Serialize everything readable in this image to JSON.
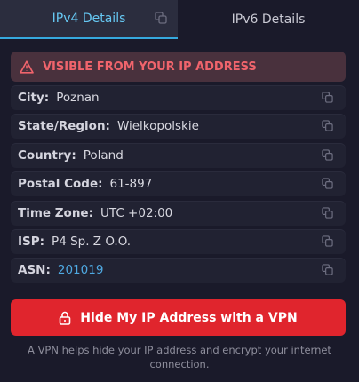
{
  "tabs": [
    {
      "label": "IPv4 Details"
    },
    {
      "label": "IPv6 Details"
    }
  ],
  "alert": {
    "text": "VISIBLE FROM YOUR IP ADDRESS",
    "icon": "warning-icon",
    "color": "#f0646c"
  },
  "details": [
    {
      "label": "City:",
      "value": "Poznan"
    },
    {
      "label": "State/Region:",
      "value": "Wielkopolskie"
    },
    {
      "label": "Country:",
      "value": "Poland"
    },
    {
      "label": "Postal Code:",
      "value": "61-897"
    },
    {
      "label": "Time Zone:",
      "value": "UTC +02:00"
    },
    {
      "label": "ISP:",
      "value": "P4 Sp. Z O.O."
    },
    {
      "label": "ASN:",
      "value": "201019"
    }
  ],
  "vpn_button": {
    "label": "Hide My IP Address with a VPN",
    "icon": "lock-icon",
    "color": "#e0252d"
  },
  "note": "A VPN helps hide your IP address and encrypt your internet connection."
}
